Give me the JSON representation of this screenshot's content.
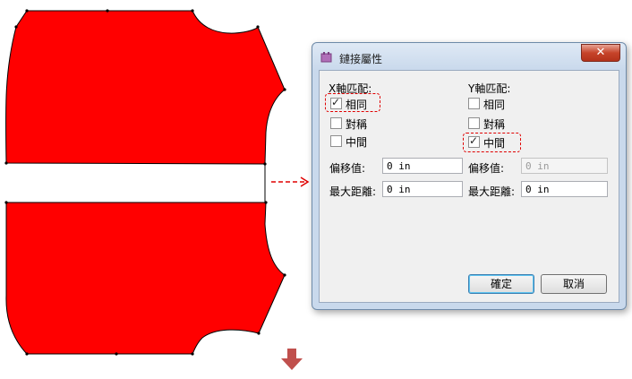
{
  "dialog": {
    "title": "鏈接屬性",
    "close_symbol": "✕",
    "x_match": {
      "heading": "X軸匹配:",
      "options": [
        {
          "label": "相同",
          "checked": true
        },
        {
          "label": "對稱",
          "checked": false
        },
        {
          "label": "中間",
          "checked": false
        }
      ],
      "offset_label": "偏移值:",
      "offset_value": "0 in",
      "max_dist_label": "最大距離:",
      "max_dist_value": "0 in"
    },
    "y_match": {
      "heading": "Y軸匹配:",
      "options": [
        {
          "label": "相同",
          "checked": false
        },
        {
          "label": "對稱",
          "checked": false
        },
        {
          "label": "中間",
          "checked": true
        }
      ],
      "offset_label": "偏移值:",
      "offset_value": "0 in",
      "max_dist_label": "最大距離:",
      "max_dist_value": "0 in"
    },
    "ok_label": "確定",
    "cancel_label": "取消"
  },
  "colors": {
    "pattern_fill": "#ff0000",
    "highlight_dash": "#e00000",
    "down_arrow": "#c0504d"
  }
}
